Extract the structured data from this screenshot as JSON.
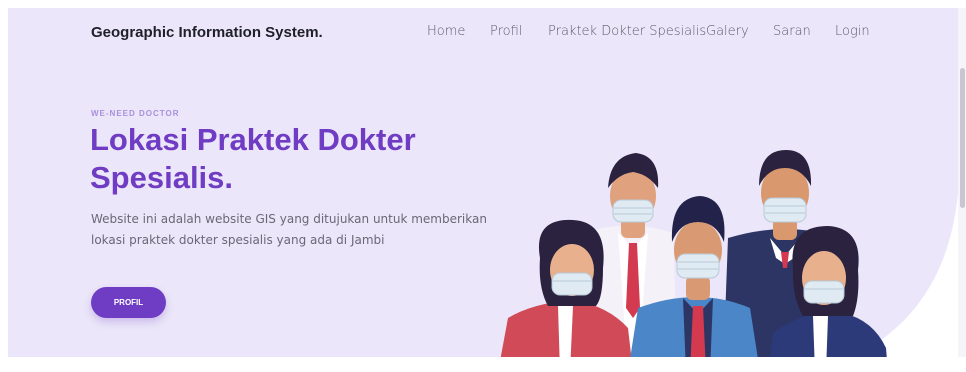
{
  "header": {
    "brand": "Geographic Information System.",
    "nav": [
      {
        "label": "Home"
      },
      {
        "label": "Profil"
      },
      {
        "label": "Praktek Dokter Spesialis"
      },
      {
        "label": "Galery"
      },
      {
        "label": "Saran"
      },
      {
        "label": "Login"
      }
    ]
  },
  "hero": {
    "eyebrow": "WE-NEED DOCTOR",
    "title_line1": "Lokasi Praktek Dokter",
    "title_line2": "Spesialis.",
    "description": "Website ini adalah website GIS yang ditujukan untuk memberikan lokasi praktek dokter spesialis yang ada di Jambi",
    "cta_label": "PROFIL"
  },
  "colors": {
    "background": "#ebe6f9",
    "accent": "#6f3cc3",
    "eyebrow": "#a98fdb"
  },
  "illustration": {
    "icon": "doctors-wearing-masks-illustration"
  }
}
